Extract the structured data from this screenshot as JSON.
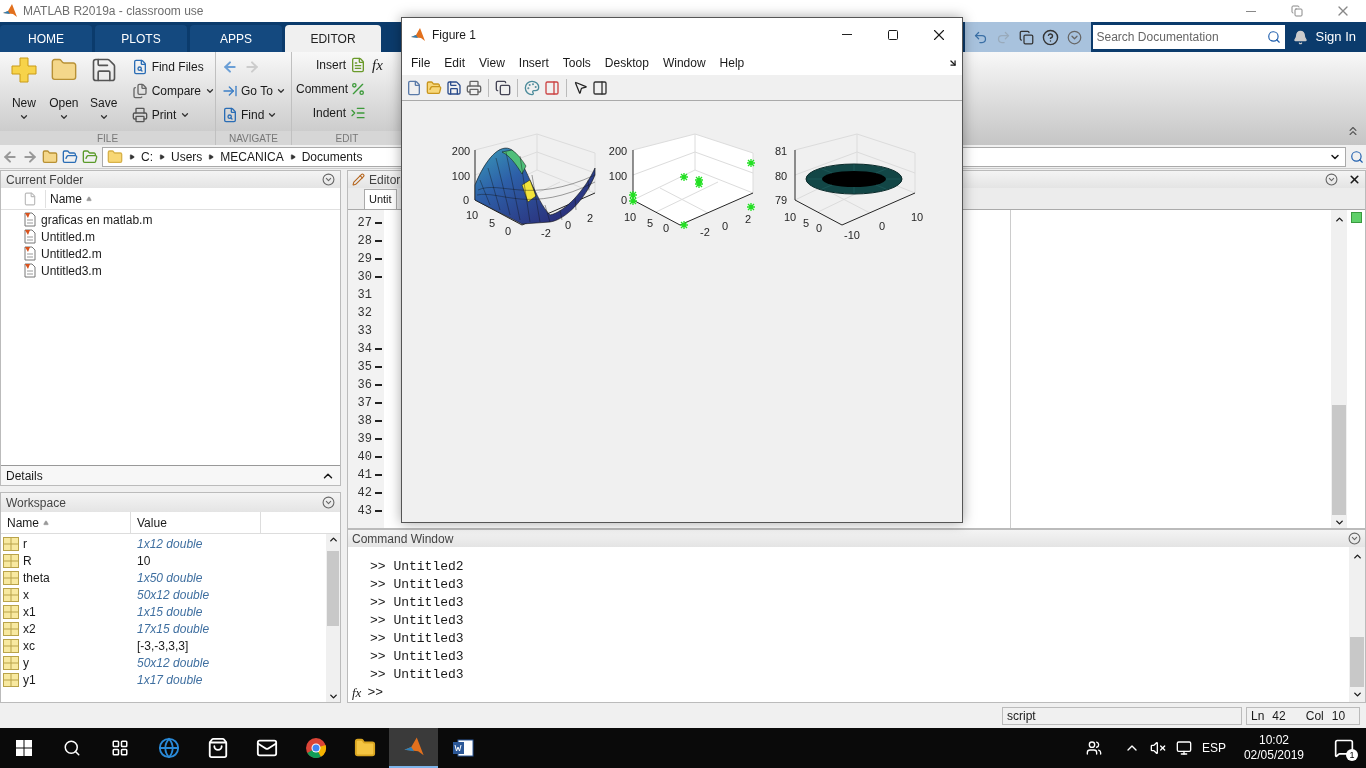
{
  "window": {
    "title": "MATLAB R2019a - classroom use"
  },
  "tabs": [
    {
      "label": "HOME",
      "selected": false
    },
    {
      "label": "PLOTS",
      "selected": false
    },
    {
      "label": "APPS",
      "selected": false
    },
    {
      "label": "EDITOR",
      "selected": true
    }
  ],
  "search": {
    "placeholder": "Search Documentation"
  },
  "sign_in": "Sign In",
  "toolstrip": {
    "file": {
      "label": "FILE",
      "large": [
        {
          "label": "New",
          "kind": "new"
        },
        {
          "label": "Open",
          "kind": "open"
        },
        {
          "label": "Save",
          "kind": "save"
        }
      ],
      "small": [
        {
          "label": "Find Files",
          "kind": "find",
          "caret": false
        },
        {
          "label": "Compare",
          "kind": "compare",
          "caret": true
        },
        {
          "label": "Print",
          "kind": "print",
          "caret": true
        }
      ]
    },
    "navigate": {
      "label": "NAVIGATE",
      "tools": [
        {
          "label": "Go To",
          "kind": "goto",
          "caret": true
        },
        {
          "label": "Find",
          "kind": "find",
          "caret": true
        }
      ]
    },
    "edit": {
      "label": "EDIT",
      "fx": "fx",
      "rows": [
        {
          "label": "Insert",
          "kind": "insert"
        },
        {
          "label": "Comment",
          "kind": "comment"
        },
        {
          "label": "Indent",
          "kind": "indent"
        }
      ]
    }
  },
  "address": {
    "segments": [
      "C:",
      "Users",
      "MECANICA",
      "Documents"
    ]
  },
  "current_folder": {
    "title": "Current Folder",
    "column": "Name",
    "files": [
      "graficas en matlab.m",
      "Untitled.m",
      "Untitled2.m",
      "Untitled3.m"
    ]
  },
  "details": {
    "title": "Details"
  },
  "workspace": {
    "title": "Workspace",
    "columns": [
      "Name",
      "Value"
    ],
    "rows": [
      {
        "name": "r",
        "value": "1x12 double",
        "kind": "summary"
      },
      {
        "name": "R",
        "value": "10",
        "kind": "literal"
      },
      {
        "name": "theta",
        "value": "1x50 double",
        "kind": "summary"
      },
      {
        "name": "x",
        "value": "50x12 double",
        "kind": "summary"
      },
      {
        "name": "x1",
        "value": "1x15 double",
        "kind": "summary"
      },
      {
        "name": "x2",
        "value": "17x15 double",
        "kind": "summary"
      },
      {
        "name": "xc",
        "value": "[-3,-3,3,3]",
        "kind": "literal"
      },
      {
        "name": "y",
        "value": "50x12 double",
        "kind": "summary"
      },
      {
        "name": "y1",
        "value": "1x17 double",
        "kind": "summary"
      }
    ]
  },
  "editor": {
    "title": "Editor",
    "tab": "Untit",
    "lines": [
      {
        "number": "27",
        "executable": true
      },
      {
        "number": "28",
        "executable": true
      },
      {
        "number": "29",
        "executable": true
      },
      {
        "number": "30",
        "executable": true
      },
      {
        "number": "31",
        "executable": false
      },
      {
        "number": "32",
        "executable": false
      },
      {
        "number": "33",
        "executable": false
      },
      {
        "number": "34",
        "executable": true
      },
      {
        "number": "35",
        "executable": true
      },
      {
        "number": "36",
        "executable": true
      },
      {
        "number": "37",
        "executable": true
      },
      {
        "number": "38",
        "executable": true
      },
      {
        "number": "39",
        "executable": true
      },
      {
        "number": "40",
        "executable": true
      },
      {
        "number": "41",
        "executable": true
      },
      {
        "number": "42",
        "executable": true
      },
      {
        "number": "43",
        "executable": true
      }
    ]
  },
  "command_window": {
    "title": "Command Window",
    "lines": [
      ">> Untitled2",
      ">> Untitled3",
      ">> Untitled3",
      ">> Untitled3",
      ">> Untitled3",
      ">> Untitled3",
      ">> Untitled3"
    ],
    "fx": "fx",
    "prompt": ">>"
  },
  "status_bar": {
    "mode": "script",
    "ln_label": "Ln",
    "ln": "42",
    "col_label": "Col",
    "col": "10"
  },
  "figure": {
    "title": "Figure 1",
    "menu": [
      "File",
      "Edit",
      "View",
      "Insert",
      "Tools",
      "Desktop",
      "Window",
      "Help"
    ],
    "axes": [
      {
        "kind": "surface",
        "z_ticks": [
          "200",
          "100",
          "0"
        ],
        "y_ticks": [
          "10",
          "5",
          "0"
        ],
        "x_ticks": [
          "-2",
          "0",
          "2"
        ]
      },
      {
        "kind": "scatter",
        "z_ticks": [
          "200",
          "100",
          "0"
        ],
        "y_ticks": [
          "10",
          "5",
          "0"
        ],
        "x_ticks": [
          "-2",
          "0",
          "2"
        ]
      },
      {
        "kind": "disk",
        "z_ticks": [
          "81",
          "80",
          "79"
        ],
        "y_ticks": [
          "10",
          "5",
          "0"
        ],
        "x_ticks": [
          "-10",
          "0",
          "10"
        ]
      }
    ]
  },
  "taskbar": {
    "apps": [
      {
        "kind": "edge",
        "selected": false
      },
      {
        "kind": "store",
        "selected": false
      },
      {
        "kind": "mail",
        "selected": false
      },
      {
        "kind": "chrome",
        "selected": false
      },
      {
        "kind": "explorer",
        "selected": false
      },
      {
        "kind": "matlab",
        "selected": true
      },
      {
        "kind": "word",
        "selected": false
      }
    ],
    "language": "ESP",
    "time": "10:02",
    "date": "02/05/2019",
    "notifications": "1"
  }
}
